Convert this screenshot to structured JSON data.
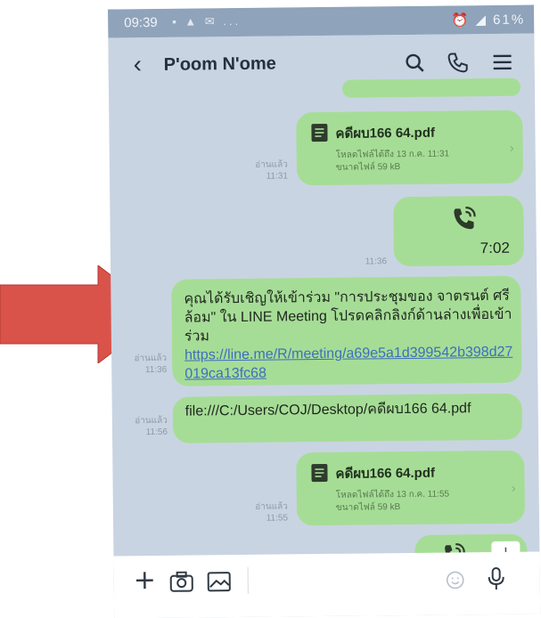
{
  "status_bar": {
    "time": "09:39",
    "indicators": "▪ ▲ ✉ ...",
    "battery": "61%"
  },
  "header": {
    "contact_name": "P'oom N'ome"
  },
  "messages": [
    {
      "type": "file",
      "file_name": "คดีผบ166 64.pdf",
      "expiry": "โหลดไฟล์ได้ถึง 13 ก.ค. 11:31",
      "size": "ขนาดไฟล์ 59 kB",
      "read": "อ่านแล้ว",
      "time": "11:31"
    },
    {
      "type": "call",
      "duration": "7:02",
      "time": "11:36"
    },
    {
      "type": "text",
      "text": "คุณได้รับเชิญให้เข้าร่วม \"การประชุมของ จาตรนต์ ศรีล้อม\" ใน LINE Meeting โปรดคลิกลิงก์ด้านล่างเพื่อเข้าร่วม",
      "link": "https://line.me/R/meeting/a69e5a1d399542b398d27019ca13fc68",
      "read": "อ่านแล้ว",
      "time": "11:36"
    },
    {
      "type": "text",
      "text": "file:///C:/Users/COJ/Desktop/คดีผบ166 64.pdf",
      "read": "อ่านแล้ว",
      "time": "11:56"
    },
    {
      "type": "file",
      "file_name": "คดีผบ166 64.pdf",
      "expiry": "โหลดไฟล์ได้ถึง 13 ก.ค. 11:55",
      "size": "ขนาดไฟล์ 59 kB",
      "read": "อ่านแล้ว",
      "time": "11:55"
    }
  ],
  "colors": {
    "bubble": "#a6dd96",
    "chat_bg": "#c9d4e2",
    "arrow": "#d9534b",
    "link": "#3e6fbc"
  }
}
